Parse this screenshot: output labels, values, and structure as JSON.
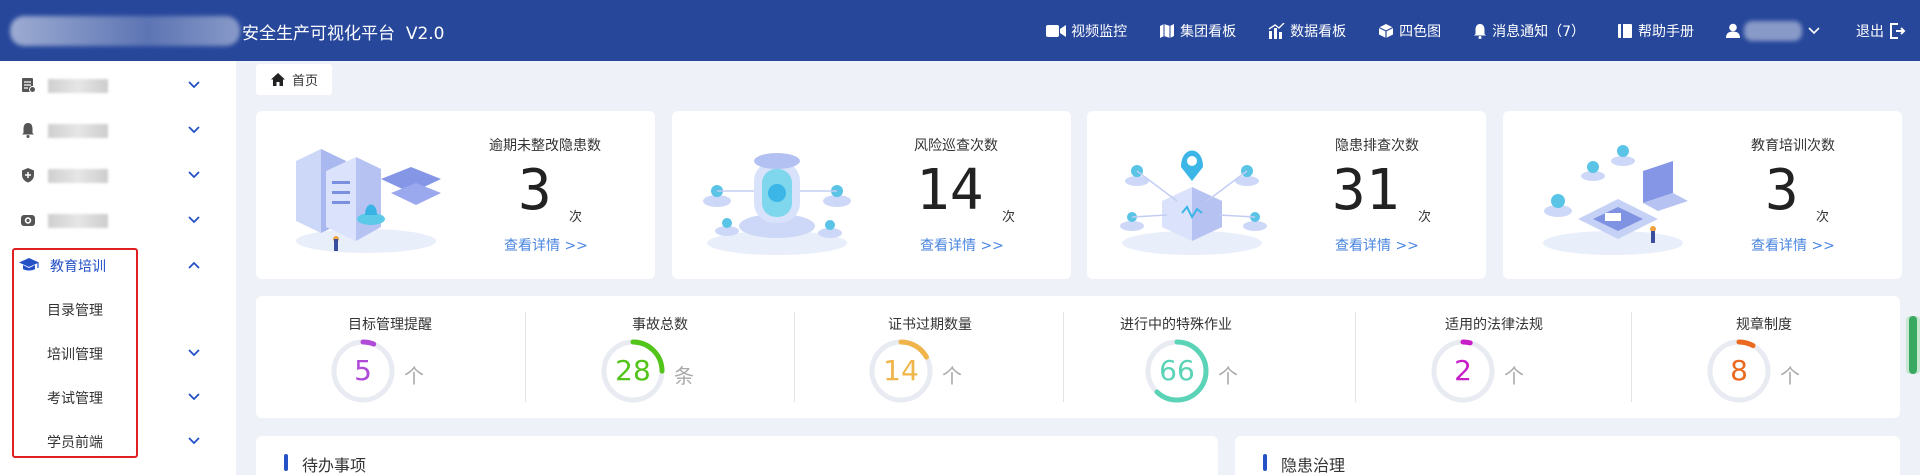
{
  "app": {
    "title": "安全生产可视化平台",
    "version": "V2.0"
  },
  "topnav": {
    "items": [
      {
        "label": "视频监控",
        "icon": "video-icon"
      },
      {
        "label": "集团看板",
        "icon": "map-icon"
      },
      {
        "label": "数据看板",
        "icon": "bar-chart-icon"
      },
      {
        "label": "四色图",
        "icon": "cube-icon"
      },
      {
        "label": "消息通知（7）",
        "icon": "bell-icon"
      },
      {
        "label": "帮助手册",
        "icon": "book-icon"
      }
    ],
    "logout": "退出"
  },
  "sidebar": {
    "items": [
      {
        "icon": "document-icon"
      },
      {
        "icon": "bell-icon"
      },
      {
        "icon": "shield-icon"
      },
      {
        "icon": "camera-icon"
      }
    ],
    "active_group": {
      "label": "教育培训",
      "icon": "graduation-cap-icon"
    },
    "subitems": [
      {
        "label": "目录管理"
      },
      {
        "label": "培训管理"
      },
      {
        "label": "考试管理"
      },
      {
        "label": "学员前端"
      }
    ]
  },
  "breadcrumb": {
    "home": "首页"
  },
  "cards": [
    {
      "title": "逾期未整改隐患数",
      "value": "3",
      "unit": "次",
      "link": "查看详情 >>"
    },
    {
      "title": "风险巡查次数",
      "value": "14",
      "unit": "次",
      "link": "查看详情 >>"
    },
    {
      "title": "隐患排查次数",
      "value": "31",
      "unit": "次",
      "link": "查看详情 >>"
    },
    {
      "title": "教育培训次数",
      "value": "3",
      "unit": "次",
      "link": "查看详情 >>"
    }
  ],
  "metrics": [
    {
      "title": "目标管理提醒",
      "value": "5",
      "unit": "个",
      "color": "#b04ad8",
      "fraction": 0.06
    },
    {
      "title": "事故总数",
      "value": "28",
      "unit": "条",
      "color": "#52c41a",
      "fraction": 0.25
    },
    {
      "title": "证书过期数量",
      "value": "14",
      "unit": "个",
      "color": "#f0b54a",
      "fraction": 0.17
    },
    {
      "title": "进行中的特殊作业",
      "value": "66",
      "unit": "个",
      "color": "#5ad3b6",
      "fraction": 0.62
    },
    {
      "title": "适用的法律法规",
      "value": "2",
      "unit": "个",
      "color": "#c81ec8",
      "fraction": 0.04
    },
    {
      "title": "规章制度",
      "value": "8",
      "unit": "个",
      "color": "#ea6a1f",
      "fraction": 0.08
    }
  ],
  "panels": [
    {
      "title": "待办事项"
    },
    {
      "title": "隐患治理"
    }
  ]
}
